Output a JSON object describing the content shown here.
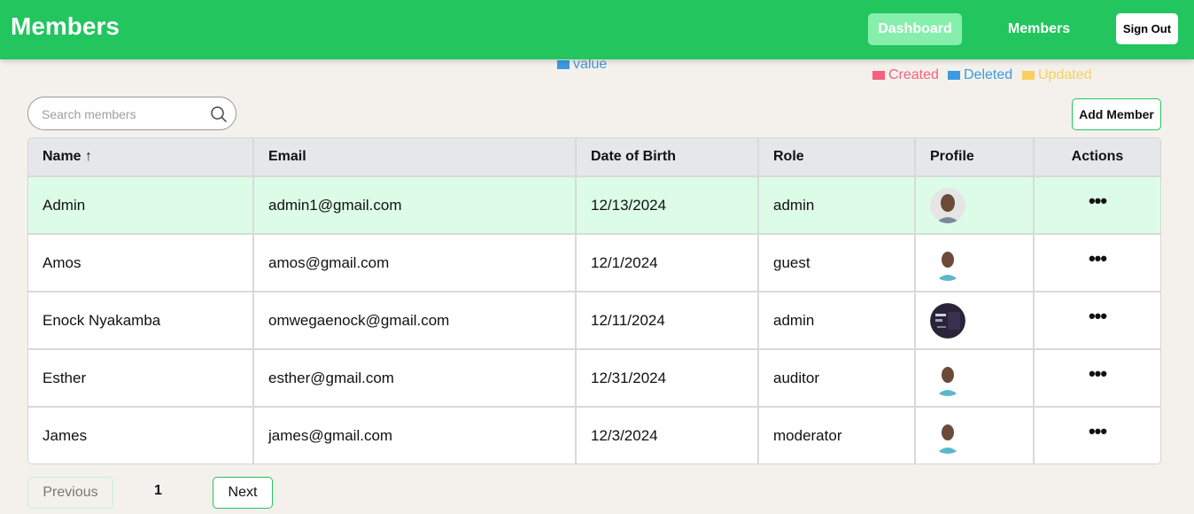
{
  "header": {
    "title": "Members",
    "nav": {
      "dashboard": "Dashboard",
      "members": "Members"
    },
    "sign_out": "Sign Out"
  },
  "legends": {
    "value": {
      "label": "value",
      "color": "#3b9ae1"
    },
    "created": {
      "label": "Created",
      "color": "#f5617f"
    },
    "deleted": {
      "label": "Deleted",
      "color": "#3b9ae1"
    },
    "updated": {
      "label": "Updated",
      "color": "#f8cf60"
    }
  },
  "search": {
    "placeholder": "Search members",
    "value": "",
    "icon": "search-icon"
  },
  "add_member_label": "Add Member",
  "table": {
    "headers": [
      "Name ↑",
      "Email",
      "Date of Birth",
      "Role",
      "Profile",
      "Actions"
    ],
    "rows": [
      {
        "name": "Admin",
        "email": "admin1@gmail.com",
        "dob": "12/13/2024",
        "role": "admin",
        "avatar": "profile-photo",
        "actions": "•••"
      },
      {
        "name": "Amos",
        "email": "amos@gmail.com",
        "dob": "12/1/2024",
        "role": "guest",
        "avatar": "profile-photo",
        "actions": "•••"
      },
      {
        "name": "Enock Nyakamba",
        "email": "omwegaenock@gmail.com",
        "dob": "12/11/2024",
        "role": "admin",
        "avatar": "dark-screenshot-photo",
        "actions": "•••"
      },
      {
        "name": "Esther",
        "email": "esther@gmail.com",
        "dob": "12/31/2024",
        "role": "auditor",
        "avatar": "profile-photo",
        "actions": "•••"
      },
      {
        "name": "James",
        "email": "james@gmail.com",
        "dob": "12/3/2024",
        "role": "moderator",
        "avatar": "profile-photo",
        "actions": "•••"
      }
    ]
  },
  "pagination": {
    "previous": "Previous",
    "page": "1",
    "next": "Next"
  },
  "colors": {
    "accent": "#22c55e",
    "selected_row": "#dcfce7",
    "nav_active": "#86efac"
  }
}
